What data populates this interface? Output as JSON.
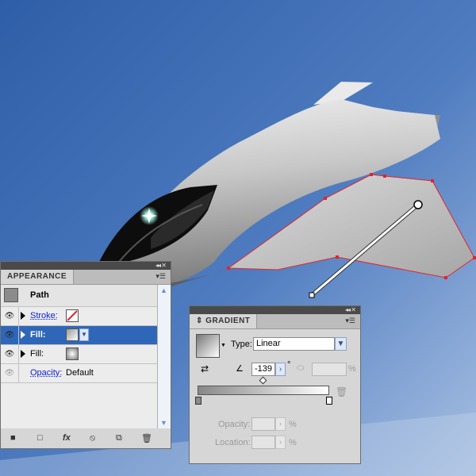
{
  "colors": {
    "sky_top": "#3f6cb6",
    "sky_bottom": "#9bb6dc",
    "selection_path": "#e0252a",
    "selected_row": "#2f67b8",
    "link_blue": "#0a1ed0",
    "panel_gray": "#d6d6d6"
  },
  "appearance": {
    "tab": "APPEARANCE",
    "header_label": "Path",
    "rows": [
      {
        "label": "Stroke:",
        "swatch": "none-swatch-icon",
        "link": true,
        "selected": false
      },
      {
        "label": "Fill:",
        "swatch": "gradient-swatch-icon",
        "link": false,
        "selected": true
      },
      {
        "label": "Fill:",
        "swatch": "gradient-swatch-icon",
        "link": false,
        "selected": false
      },
      {
        "label": "Opacity:",
        "value": "Default",
        "link": true,
        "selected": false
      }
    ],
    "footer_icons": [
      "new-art-basic-icon",
      "clear-appearance-icon",
      "fx-icon",
      "clear-icon",
      "duplicate-item-icon",
      "trash-icon"
    ],
    "fx_label": "fx"
  },
  "gradient": {
    "tab": "GRADIENT",
    "type_label": "Type:",
    "type_value": "Linear",
    "angle_value": "-139",
    "angle_unit": "°",
    "aspect_unit": "%",
    "opacity_label": "Opacity:",
    "opacity_unit": "%",
    "location_label": "Location:",
    "location_unit": "%"
  },
  "scene_icons": [
    "fighter-jet-illustration",
    "gradient-annotator-icon",
    "lens-glint-icon"
  ]
}
